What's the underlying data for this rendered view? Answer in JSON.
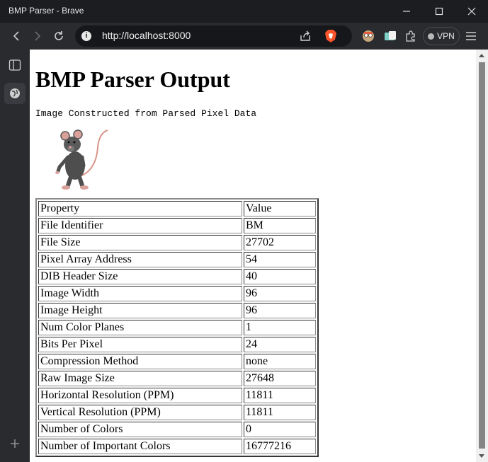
{
  "window": {
    "title": "BMP Parser - Brave",
    "controls": {
      "minimize_icon": "minimize-icon",
      "maximize_icon": "maximize-icon",
      "close_icon": "close-icon"
    }
  },
  "toolbar": {
    "url": "http://localhost:8000",
    "vpn_label": "VPN",
    "icons": [
      "back-icon",
      "forward-icon",
      "reload-icon",
      "site-info-icon",
      "share-icon",
      "brave-shields-icon",
      "profile-icon",
      "wallet-icon",
      "extensions-icon",
      "menu-icon"
    ]
  },
  "sidebar": {
    "items": [
      "sidebar-panel-icon",
      "globe-icon",
      "add-icon"
    ]
  },
  "page": {
    "heading": "BMP Parser Output",
    "subtitle": "Image Constructed from Parsed Pixel Data",
    "image_alt": "rat image",
    "table": {
      "header": [
        "Property",
        "Value"
      ],
      "rows": [
        [
          "File Identifier",
          "BM"
        ],
        [
          "File Size",
          "27702"
        ],
        [
          "Pixel Array Address",
          "54"
        ],
        [
          "DIB Header Size",
          "40"
        ],
        [
          "Image Width",
          "96"
        ],
        [
          "Image Height",
          "96"
        ],
        [
          "Num Color Planes",
          "1"
        ],
        [
          "Bits Per Pixel",
          "24"
        ],
        [
          "Compression Method",
          "none"
        ],
        [
          "Raw Image Size",
          "27648"
        ],
        [
          "Horizontal Resolution (PPM)",
          "11811"
        ],
        [
          "Vertical Resolution (PPM)",
          "11811"
        ],
        [
          "Number of Colors",
          "0"
        ],
        [
          "Number of Important Colors",
          "16777216"
        ]
      ]
    }
  }
}
